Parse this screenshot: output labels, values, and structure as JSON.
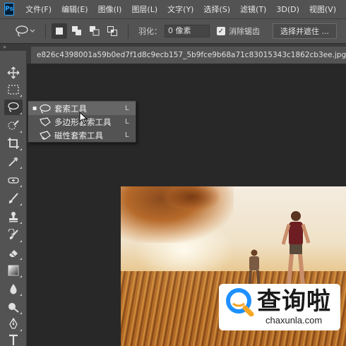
{
  "app": {
    "logo_text": "Ps"
  },
  "menubar": {
    "items": [
      "文件(F)",
      "编辑(E)",
      "图像(I)",
      "图层(L)",
      "文字(Y)",
      "选择(S)",
      "滤镜(T)",
      "3D(D)",
      "视图(V)"
    ]
  },
  "options": {
    "feather_label": "羽化：",
    "feather_value": "0 像素",
    "antialias_checked": true,
    "antialias_label": "消除锯齿",
    "select_mask_label": "选择并遮住 ..."
  },
  "document": {
    "tab_title": "e826c4398001a59b0ed7f1d8c9ecb157_5b9fce9b68a71c83015343c1862cb3ee.jpg @ 37."
  },
  "panel": {
    "collapse_glyph": "»"
  },
  "flyout": {
    "items": [
      {
        "label": "套索工具",
        "shortcut": "L",
        "icon": "lasso-icon",
        "active": true,
        "marker": "▪"
      },
      {
        "label": "多边形套索工具",
        "shortcut": "L",
        "icon": "polygonal-lasso-icon",
        "active": false,
        "marker": ""
      },
      {
        "label": "磁性套索工具",
        "shortcut": "L",
        "icon": "magnetic-lasso-icon",
        "active": false,
        "marker": ""
      }
    ]
  },
  "toolbar": {
    "tools": [
      "move-tool-icon",
      "marquee-tool-icon",
      "lasso-tool-icon",
      "quick-selection-tool-icon",
      "crop-tool-icon",
      "eyedropper-tool-icon",
      "healing-brush-tool-icon",
      "brush-tool-icon",
      "clone-stamp-tool-icon",
      "history-brush-tool-icon",
      "eraser-tool-icon",
      "gradient-tool-icon",
      "blur-tool-icon",
      "dodge-tool-icon",
      "pen-tool-icon",
      "type-tool-icon"
    ],
    "active_tool": "lasso-tool-icon"
  },
  "watermark": {
    "chinese_text": "查询啦",
    "url": "chaxunla.com"
  },
  "colors": {
    "ui_panel": "#535353",
    "ui_dark": "#282828",
    "watermark_blue": "#1e90ff",
    "watermark_orange": "#f5a623"
  }
}
